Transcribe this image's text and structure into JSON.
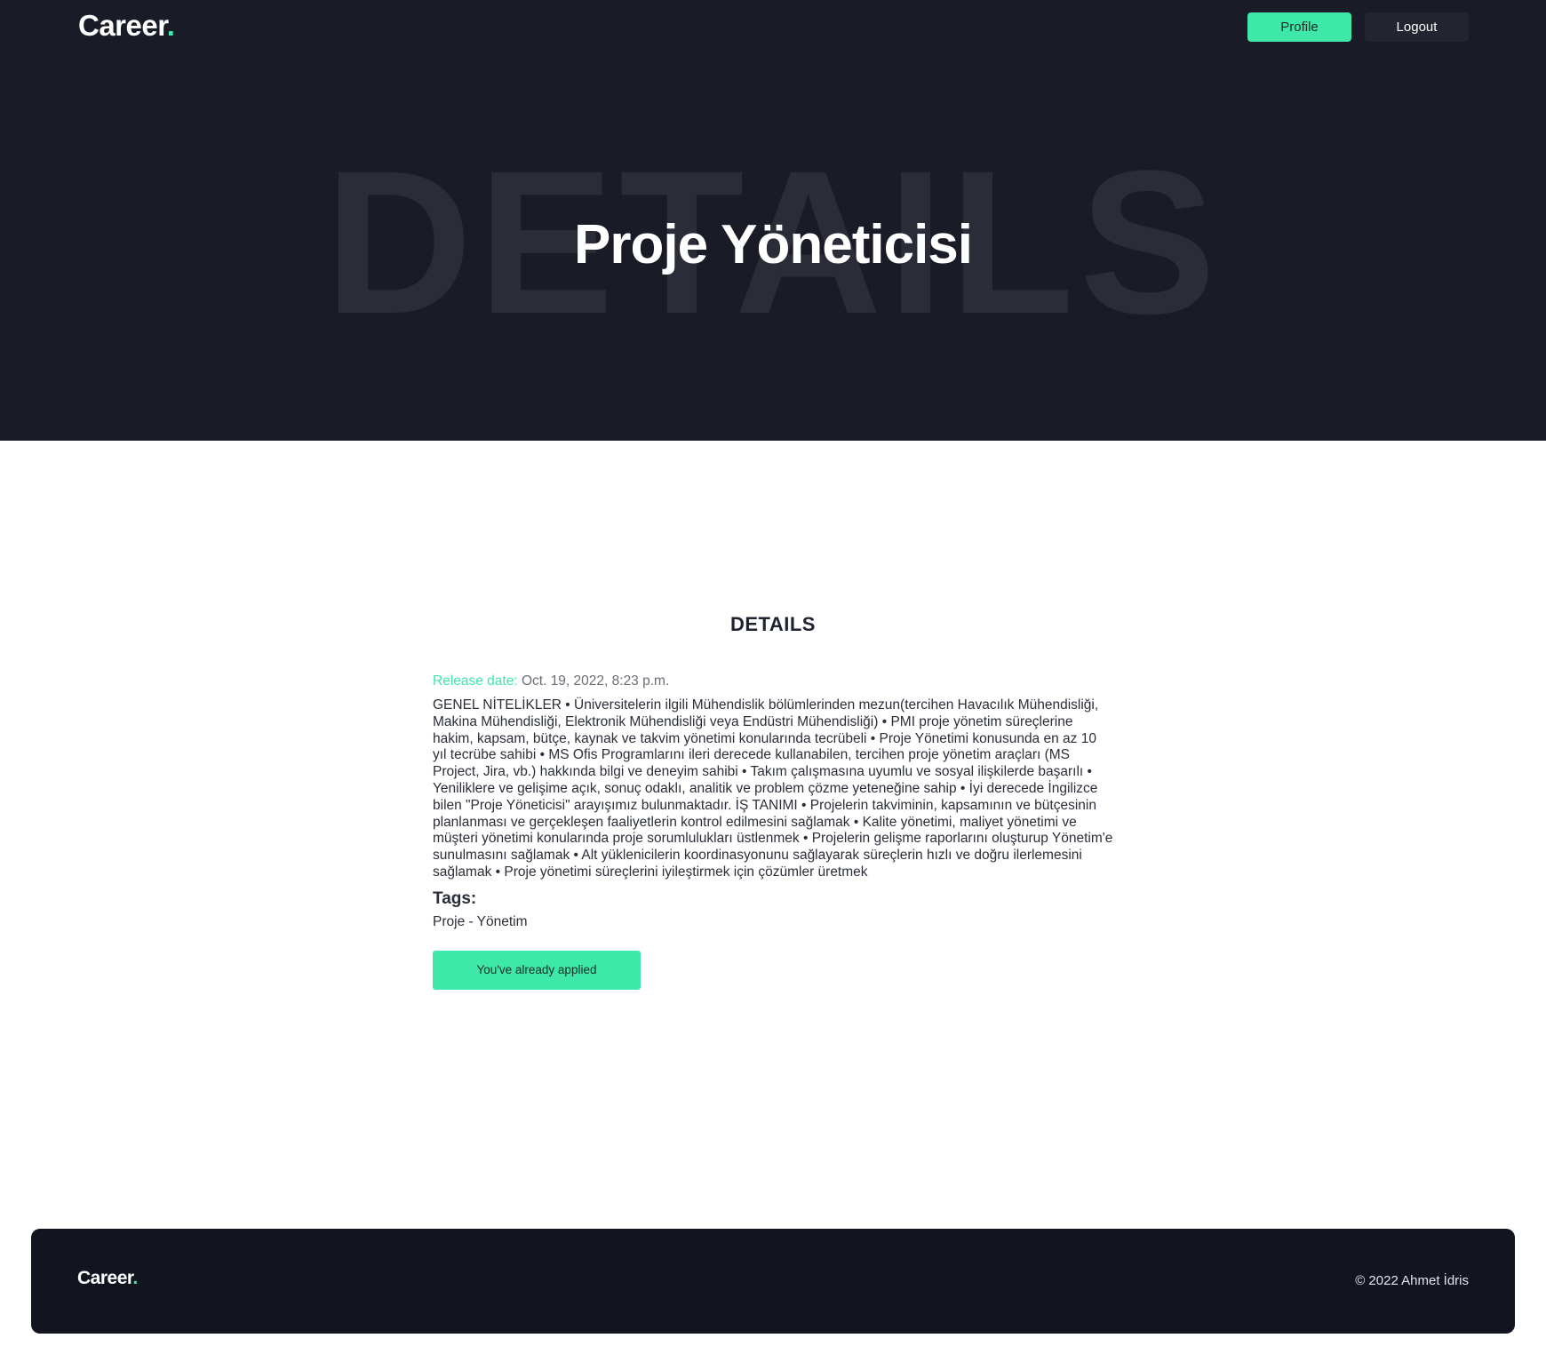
{
  "brand": {
    "name": "Career",
    "dot": ".",
    "accent_color": "#3de8a8",
    "dark_color": "#191b27"
  },
  "nav": {
    "profile_label": "Profile",
    "logout_label": "Logout"
  },
  "hero": {
    "background_word": "DETAILS",
    "title": "Proje Yöneticisi"
  },
  "details": {
    "heading": "DETAILS",
    "release_label": "Release date:",
    "release_value": " Oct. 19, 2022, 8:23 p.m.",
    "description": "GENEL NİTELİKLER • Üniversitelerin ilgili Mühendislik bölümlerinden mezun(tercihen Havacılık Mühendisliği, Makina Mühendisliği, Elektronik Mühendisliği veya Endüstri Mühendisliği) • PMI proje yönetim süreçlerine hakim, kapsam, bütçe, kaynak ve takvim yönetimi konularında tecrübeli • Proje Yönetimi konusunda en az 10 yıl tecrübe sahibi • MS Ofis Programlarını ileri derecede kullanabilen, tercihen proje yönetim araçları (MS Project, Jira, vb.) hakkında bilgi ve deneyim sahibi • Takım çalışmasına uyumlu ve sosyal ilişkilerde başarılı • Yeniliklere ve gelişime açık, sonuç odaklı, analitik ve problem çözme yeteneğine sahip • İyi derecede İngilizce bilen \"Proje Yöneticisi\" arayışımız bulunmaktadır. İŞ TANIMI • Projelerin takviminin, kapsamının ve bütçesinin planlanması ve gerçekleşen faaliyetlerin kontrol edilmesini sağlamak • Kalite yönetimi, maliyet yönetimi ve müşteri yönetimi konularında proje sorumlulukları üstlenmek • Projelerin gelişme raporlarını oluşturup Yönetim'e sunulmasını sağlamak • Alt yüklenicilerin koordinasyonunu sağlayarak süreçlerin hızlı ve doğru ilerlemesini sağlamak • Proje yönetimi süreçlerini iyileştirmek için çözümler üretmek",
    "tags_heading": "Tags:",
    "tags_value": "Proje - Yönetim",
    "applied_button_label": "You've already applied"
  },
  "footer": {
    "copyright": "© 2022 Ahmet İdris"
  }
}
